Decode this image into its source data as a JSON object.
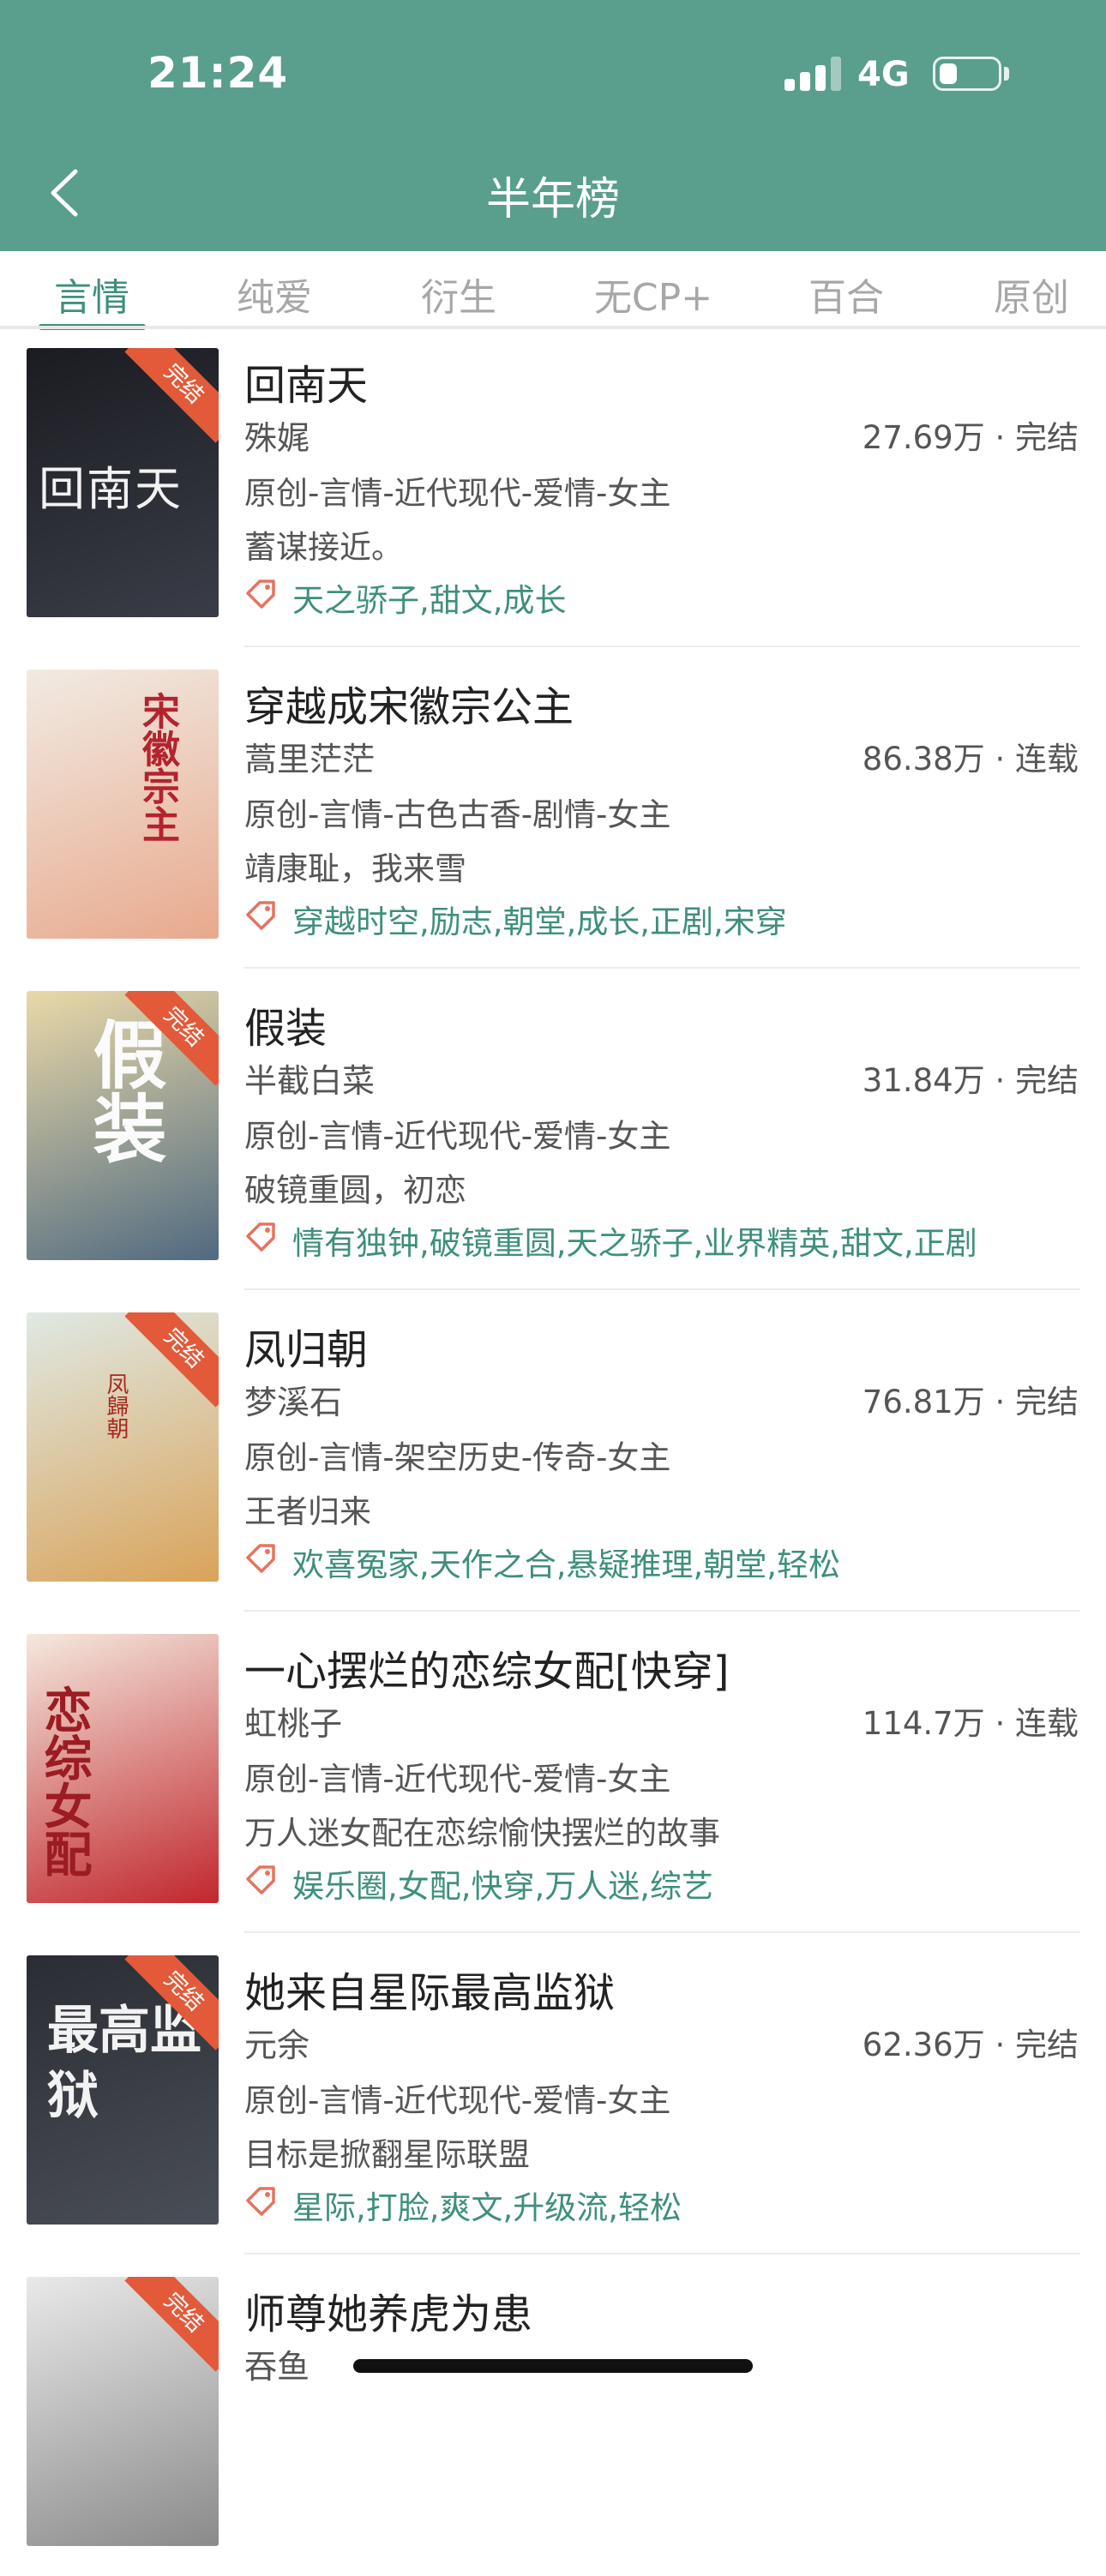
{
  "status_bar": {
    "time": "21:24",
    "network": "4G"
  },
  "header": {
    "title": "半年榜"
  },
  "tabs": [
    {
      "label": "言情",
      "active": true
    },
    {
      "label": "纯爱",
      "active": false
    },
    {
      "label": "衍生",
      "active": false
    },
    {
      "label": "无CP+",
      "active": false
    },
    {
      "label": "百合",
      "active": false
    },
    {
      "label": "原创",
      "active": false
    }
  ],
  "badge_label": "完结",
  "books": [
    {
      "title": "回南天",
      "author": "殊娓",
      "stats": "27.69万 · 完结",
      "genre": "原创-言情-近代现代-爱情-女主",
      "desc": "蓄谋接近。",
      "tags": "天之骄子,甜文,成长",
      "badge": true,
      "cover_text": "回南天",
      "cover_colors": [
        "#1b1c22",
        "#3a3d47"
      ]
    },
    {
      "title": "穿越成宋徽宗公主",
      "author": "蒿里茫茫",
      "stats": "86.38万 · 连载",
      "genre": "原创-言情-古色古香-剧情-女主",
      "desc": "靖康耻，我来雪",
      "tags": "穿越时空,励志,朝堂,成长,正剧,宋穿",
      "badge": false,
      "cover_text": "宋徽宗主",
      "cover_colors": [
        "#f1ebe3",
        "#e8a98d"
      ]
    },
    {
      "title": "假装",
      "author": "半截白菜",
      "stats": "31.84万 · 完结",
      "genre": "原创-言情-近代现代-爱情-女主",
      "desc": "破镜重圆，初恋",
      "tags": "情有独钟,破镜重圆,天之骄子,业界精英,甜文,正剧",
      "badge": true,
      "cover_text": "假装",
      "cover_colors": [
        "#ead9a8",
        "#506a80"
      ]
    },
    {
      "title": "凤归朝",
      "author": "梦溪石",
      "stats": "76.81万 · 完结",
      "genre": "原创-言情-架空历史-传奇-女主",
      "desc": "王者归来",
      "tags": "欢喜冤家,天作之合,悬疑推理,朝堂,轻松",
      "badge": true,
      "cover_text": "凤歸朝",
      "cover_colors": [
        "#dfe9e4",
        "#d9a35a"
      ]
    },
    {
      "title": "一心摆烂的恋综女配[快穿]",
      "author": "虹桃子",
      "stats": "114.7万 · 连载",
      "genre": "原创-言情-近代现代-爱情-女主",
      "desc": "万人迷女配在恋综愉快摆烂的故事",
      "tags": "娱乐圈,女配,快穿,万人迷,综艺",
      "badge": false,
      "cover_text": "恋综女配",
      "cover_colors": [
        "#f4e9de",
        "#c1272d"
      ]
    },
    {
      "title": "她来自星际最高监狱",
      "author": "元余",
      "stats": "62.36万 · 完结",
      "genre": "原创-言情-近代现代-爱情-女主",
      "desc": "目标是掀翻星际联盟",
      "tags": "星际,打脸,爽文,升级流,轻松",
      "badge": true,
      "cover_text": "最高监狱",
      "cover_colors": [
        "#2a2d33",
        "#4a4e57"
      ]
    },
    {
      "title": "师尊她养虎为患",
      "author": "吞鱼",
      "stats": "",
      "genre": "",
      "desc": "",
      "tags": "",
      "badge": true,
      "cover_text": "",
      "cover_colors": [
        "#e9e9e9",
        "#8a8a8a"
      ]
    }
  ],
  "colors": {
    "header": "#5a9e8d",
    "accent": "#3e8f7d",
    "badge": "#e25a3a",
    "tag_icon": "#e5735f"
  }
}
